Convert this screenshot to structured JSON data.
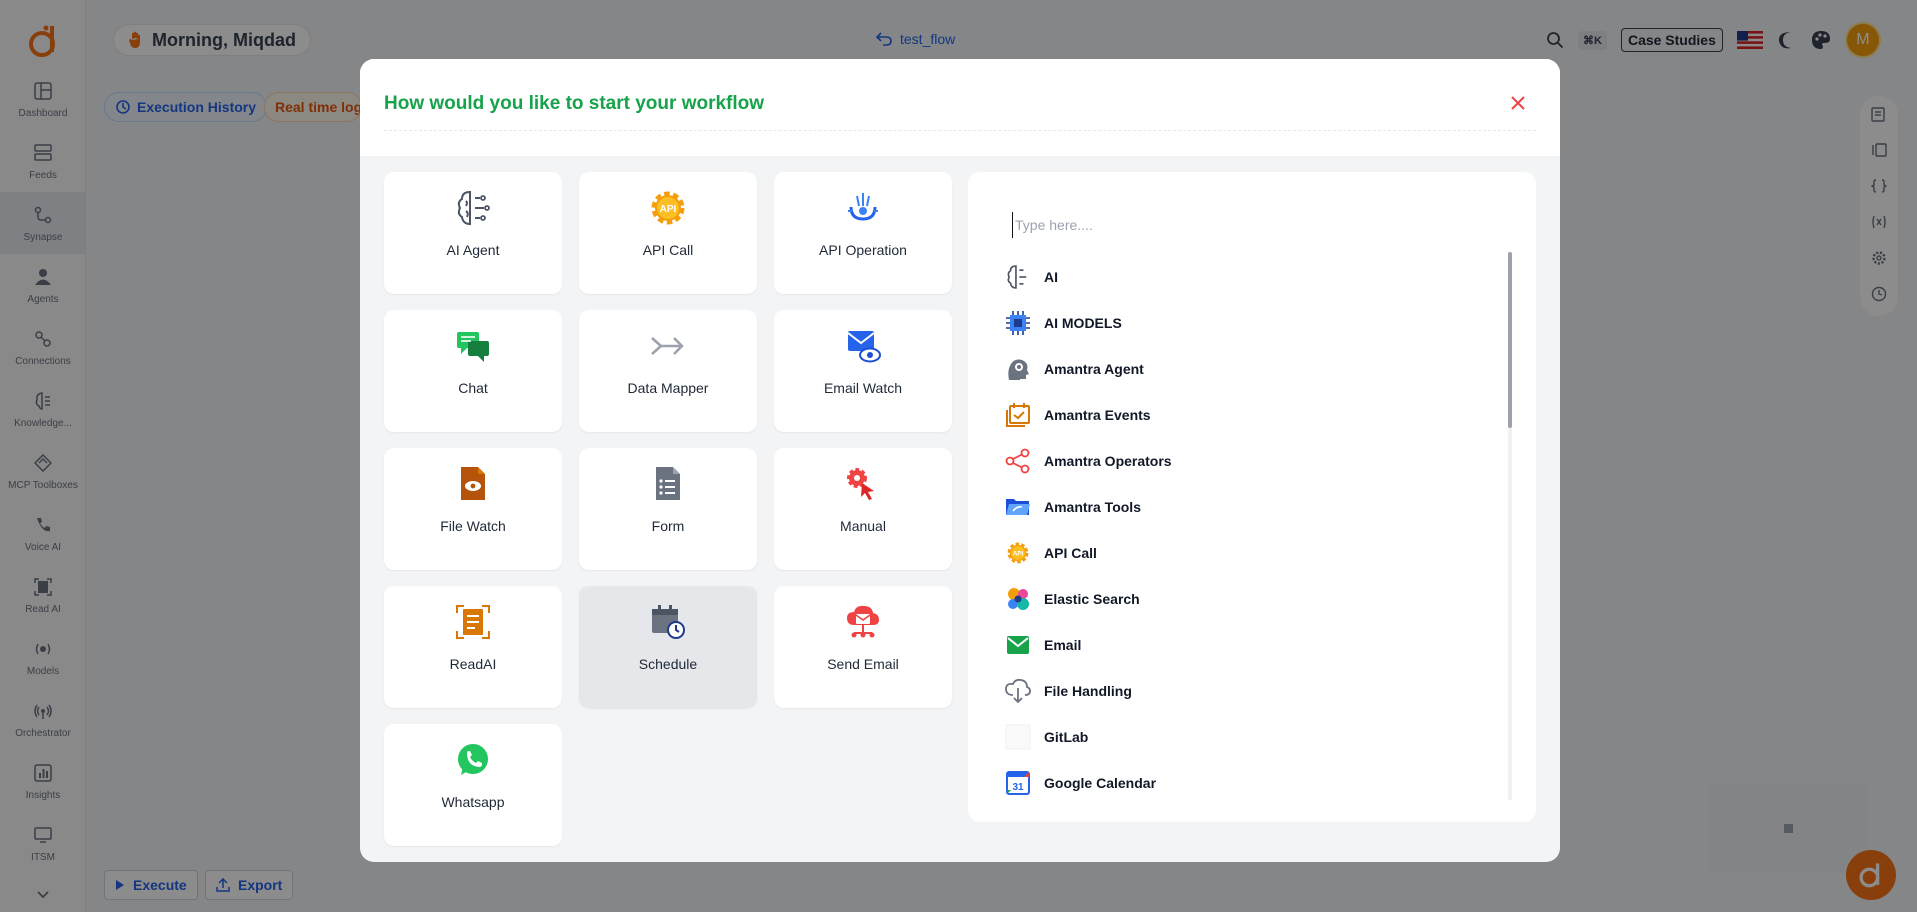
{
  "topbar": {
    "greeting": "Morning, Miqdad",
    "flow_name": "test_flow",
    "shortcut": "⌘K",
    "case_studies": "Case Studies",
    "avatar_initial": "M"
  },
  "sidebar": {
    "items": [
      {
        "label": "Dashboard"
      },
      {
        "label": "Feeds"
      },
      {
        "label": "Synapse"
      },
      {
        "label": "Agents"
      },
      {
        "label": "Connections"
      },
      {
        "label": "Knowledge..."
      },
      {
        "label": "MCP Toolboxes"
      },
      {
        "label": "Voice AI"
      },
      {
        "label": "Read AI"
      },
      {
        "label": "Models"
      },
      {
        "label": "Orchestrator"
      },
      {
        "label": "Insights"
      },
      {
        "label": "ITSM"
      }
    ]
  },
  "canvas": {
    "execution_history": "Execution History",
    "realtime_logs": "Real time logs",
    "execute": "Execute",
    "export": "Export"
  },
  "modal": {
    "title": "How would you like to start your workflow",
    "cards": [
      {
        "label": "AI Agent",
        "icon": "brain-icon"
      },
      {
        "label": "API Call",
        "icon": "api-gear-icon"
      },
      {
        "label": "API Operation",
        "icon": "api-operation-icon"
      },
      {
        "label": "Chat",
        "icon": "chat-icon"
      },
      {
        "label": "Data Mapper",
        "icon": "double-arrow-icon"
      },
      {
        "label": "Email Watch",
        "icon": "email-watch-icon"
      },
      {
        "label": "File Watch",
        "icon": "file-watch-icon"
      },
      {
        "label": "Form",
        "icon": "form-icon"
      },
      {
        "label": "Manual",
        "icon": "manual-click-icon"
      },
      {
        "label": "ReadAI",
        "icon": "readai-icon"
      },
      {
        "label": "Schedule",
        "icon": "schedule-icon"
      },
      {
        "label": "Send Email",
        "icon": "send-email-icon"
      },
      {
        "label": "Whatsapp",
        "icon": "whatsapp-icon"
      }
    ],
    "search": {
      "placeholder": "Type here...."
    },
    "list": [
      {
        "label": "AI",
        "icon": "brain-icon"
      },
      {
        "label": "AI MODELS",
        "icon": "chip-icon"
      },
      {
        "label": "Amantra Agent",
        "icon": "agent-head-icon"
      },
      {
        "label": "Amantra Events",
        "icon": "events-icon"
      },
      {
        "label": "Amantra Operators",
        "icon": "share-nodes-icon"
      },
      {
        "label": "Amantra Tools",
        "icon": "folder-icon"
      },
      {
        "label": "API Call",
        "icon": "api-gear-icon"
      },
      {
        "label": "Elastic Search",
        "icon": "elastic-icon"
      },
      {
        "label": "Email",
        "icon": "email-icon"
      },
      {
        "label": "File Handling",
        "icon": "cloud-download-icon"
      },
      {
        "label": "GitLab",
        "icon": "gitlab-icon"
      },
      {
        "label": "Google Calendar",
        "icon": "google-calendar-icon"
      }
    ]
  },
  "colors": {
    "title_green": "#16a34a",
    "close_red": "#ef4444",
    "accent_blue": "#2563eb",
    "accent_orange": "#f97316"
  }
}
